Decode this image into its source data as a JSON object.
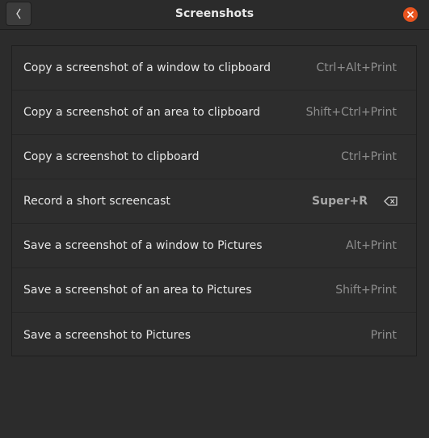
{
  "header": {
    "title": "Screenshots",
    "back_icon": "chevron-left-icon",
    "close_icon": "close-icon",
    "close_color": "#e9541f"
  },
  "shortcuts": [
    {
      "label": "Copy a screenshot of a window to clipboard",
      "accel": "Ctrl+Alt+Print"
    },
    {
      "label": "Copy a screenshot of an area to clipboard",
      "accel": "Shift+Ctrl+Print"
    },
    {
      "label": "Copy a screenshot to clipboard",
      "accel": "Ctrl+Print"
    },
    {
      "label": "Record a short screencast",
      "accel": "Super+R",
      "custom": true,
      "reset_icon": "backspace-icon"
    },
    {
      "label": "Save a screenshot of a window to Pictures",
      "accel": "Alt+Print"
    },
    {
      "label": "Save a screenshot of an area to Pictures",
      "accel": "Shift+Print"
    },
    {
      "label": "Save a screenshot to Pictures",
      "accel": "Print"
    }
  ]
}
